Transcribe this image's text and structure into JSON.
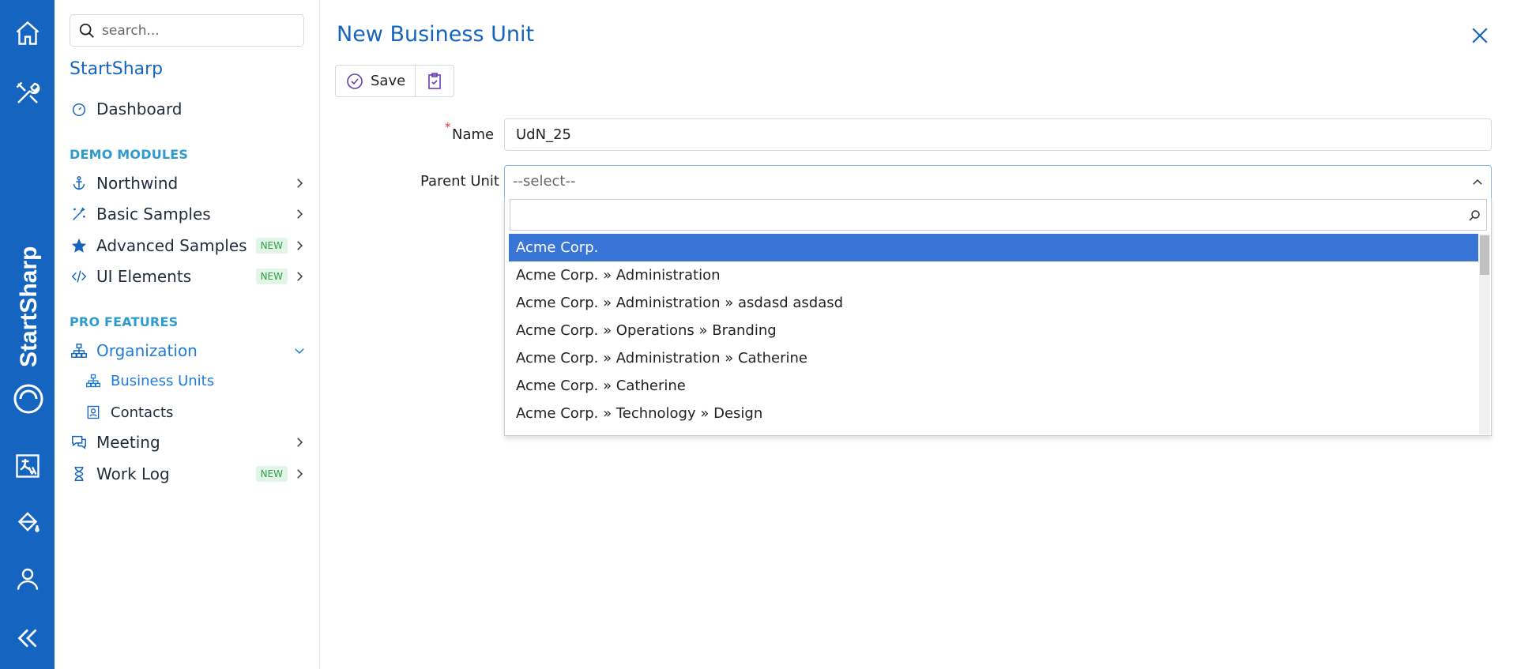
{
  "rail": {
    "brand": "StartSharp",
    "icons": [
      "home-icon",
      "tools-icon",
      "translate-icon",
      "paint-bucket-icon",
      "user-icon",
      "collapse-icon"
    ]
  },
  "sidebar": {
    "search_placeholder": "search...",
    "app_title": "StartSharp",
    "dashboard": "Dashboard",
    "section_demo": "DEMO MODULES",
    "demo_items": [
      {
        "label": "Northwind",
        "badge": ""
      },
      {
        "label": "Basic Samples",
        "badge": ""
      },
      {
        "label": "Advanced Samples",
        "badge": "NEW"
      },
      {
        "label": "UI Elements",
        "badge": "NEW"
      }
    ],
    "section_pro": "PRO FEATURES",
    "organization": "Organization",
    "org_children": [
      "Business Units",
      "Contacts"
    ],
    "pro_items": [
      {
        "label": "Meeting",
        "badge": ""
      },
      {
        "label": "Work Log",
        "badge": "NEW"
      }
    ],
    "accent": "#1565c0",
    "section_color": "#2e9bcf"
  },
  "dialog": {
    "title": "New Business Unit",
    "save_label": "Save",
    "name_label": "Name",
    "name_required_mark": "*",
    "name_value": "UdN_25",
    "parent_label": "Parent Unit",
    "parent_placeholder": "--select--",
    "dropdown_search_value": "",
    "options": [
      "Acme Corp.",
      "Acme Corp. » Administration",
      "Acme Corp. » Administration » asdasd asdasd",
      "Acme Corp. » Operations » Branding",
      "Acme Corp. » Administration » Catherine",
      "Acme Corp. » Catherine",
      "Acme Corp. » Technology » Design"
    ],
    "selected_index": 0,
    "highlight_color": "#3875d7"
  }
}
